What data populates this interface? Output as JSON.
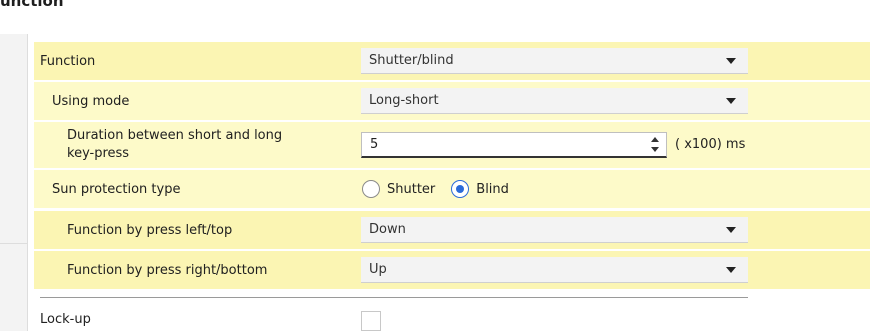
{
  "section": {
    "title": "unction"
  },
  "rows": {
    "function": {
      "label": "Function",
      "value": "Shutter/blind"
    },
    "using_mode": {
      "label": "Using mode",
      "value": "Long-short"
    },
    "duration": {
      "label": "Duration between short and long key-press",
      "value": "5",
      "unit": "( x100) ms"
    },
    "sun_protection": {
      "label": "Sun protection type",
      "options": [
        "Shutter",
        "Blind"
      ],
      "selected": "Blind"
    },
    "press_left": {
      "label": "Function by press left/top",
      "value": "Down"
    },
    "press_right": {
      "label": "Function by press right/bottom",
      "value": "Up"
    },
    "lock_up": {
      "label": "Lock-up",
      "checked": false
    }
  },
  "colors": {
    "row_bg": "#fdfac9",
    "row_bg_highlight": "#fbf5b3",
    "accent": "#2b6bd9"
  },
  "icons": {
    "dropdown": "chevron-down-icon",
    "spinner": "spin-arrows-icon"
  }
}
